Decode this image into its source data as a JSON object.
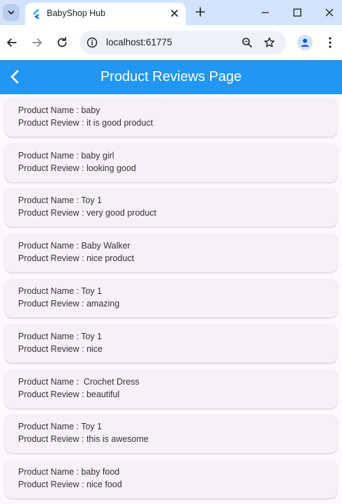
{
  "browser": {
    "tab_title": "BabyShop Hub",
    "url": "localhost:61775"
  },
  "appbar": {
    "title": "Product Reviews Page"
  },
  "reviews": [
    {
      "name_line": "Product Name : baby",
      "review_line": "Product Review : it is good product"
    },
    {
      "name_line": "Product Name : baby girl",
      "review_line": "Product Review : looking good"
    },
    {
      "name_line": "Product Name : Toy 1",
      "review_line": "Product Review : very good product"
    },
    {
      "name_line": "Product Name : Baby Walker",
      "review_line": "Product Review : nice product"
    },
    {
      "name_line": "Product Name : Toy 1",
      "review_line": "Product Review : amazing"
    },
    {
      "name_line": "Product Name : Toy 1",
      "review_line": "Product Review : nice"
    },
    {
      "name_line": "Product Name :  Crochet Dress",
      "review_line": "Product Review : beautiful"
    },
    {
      "name_line": "Product Name : Toy 1",
      "review_line": "Product Review : this is awesome"
    },
    {
      "name_line": "Product Name : baby food",
      "review_line": "Product Review : nice food"
    }
  ],
  "colors": {
    "app_bar": "#2196f3",
    "card": "#f7f0f9",
    "page": "#fdf7ff",
    "tab_strip": "#d3e3fd"
  },
  "icons": {
    "tab_search": "chevron-down-icon",
    "favicon": "flutter-icon",
    "tab_close": "close-icon",
    "new_tab": "plus-icon",
    "minimize": "minimize-icon",
    "maximize": "maximize-icon",
    "close_window": "close-icon",
    "back": "arrow-left-icon",
    "forward": "arrow-right-icon",
    "reload": "reload-icon",
    "site_info": "site-info-icon",
    "zoom": "zoom-icon",
    "bookmark": "star-icon",
    "profile": "profile-icon",
    "menu": "kebab-menu-icon",
    "app_back": "chevron-left-icon"
  }
}
